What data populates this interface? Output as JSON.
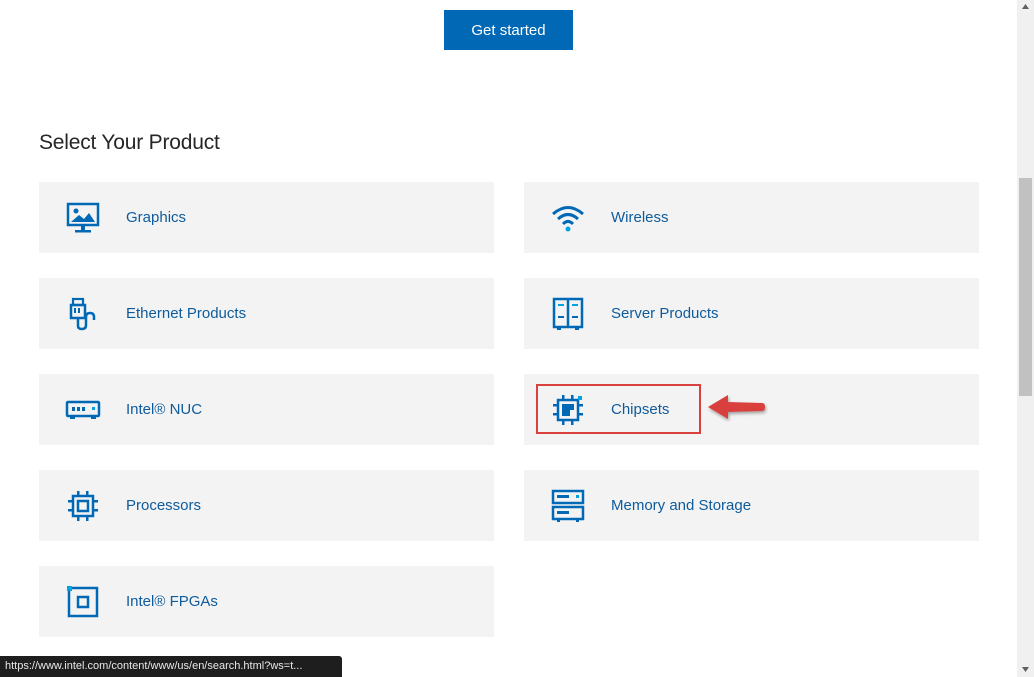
{
  "get_started_label": "Get started",
  "section_title": "Select Your Product",
  "products": [
    {
      "label": "Graphics",
      "icon": "monitor-image-icon"
    },
    {
      "label": "Wireless",
      "icon": "wifi-icon"
    },
    {
      "label": "Ethernet Products",
      "icon": "ethernet-cable-icon"
    },
    {
      "label": "Server Products",
      "icon": "server-icon"
    },
    {
      "label": "Intel® NUC",
      "icon": "mini-pc-icon"
    },
    {
      "label": "Chipsets",
      "icon": "chipset-icon"
    },
    {
      "label": "Processors",
      "icon": "processor-icon"
    },
    {
      "label": "Memory and Storage",
      "icon": "storage-icon"
    },
    {
      "label": "Intel® FPGAs",
      "icon": "fpga-icon"
    }
  ],
  "status_url": "https://www.intel.com/content/www/us/en/search.html?ws=t...",
  "colors": {
    "accent": "#0068b5",
    "label": "#0e5b9c",
    "card_bg": "#f3f3f3",
    "highlight": "#d9413e"
  }
}
